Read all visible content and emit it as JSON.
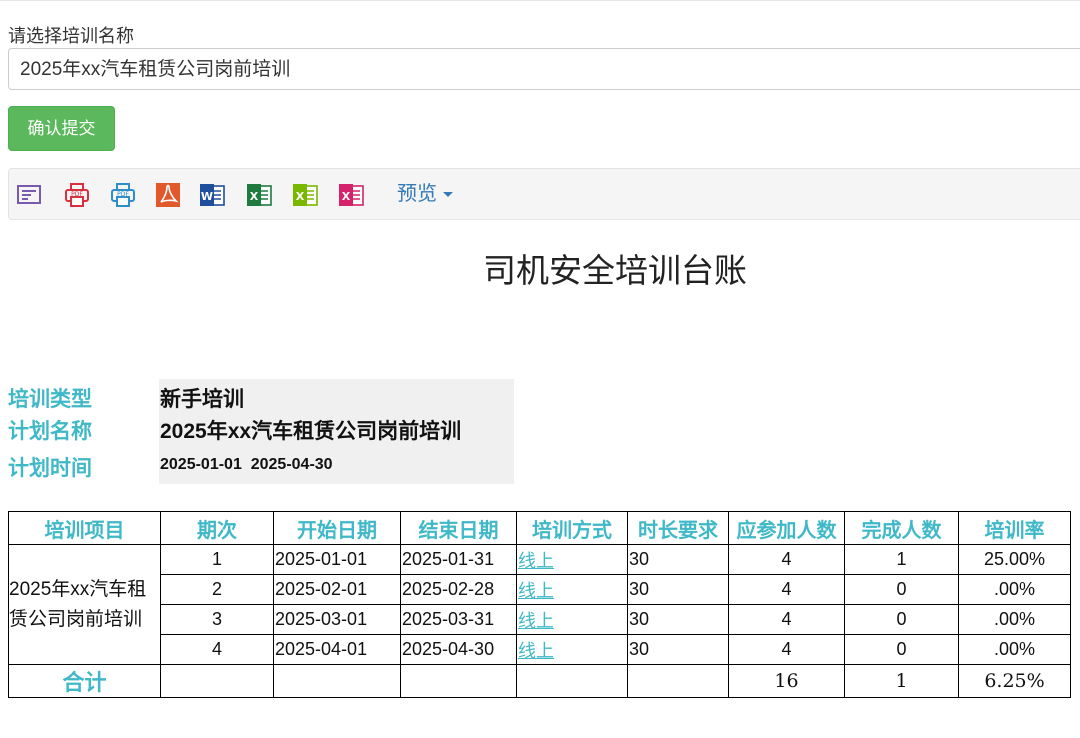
{
  "form": {
    "label": "请选择培训名称",
    "selected": "2025年xx汽车租赁公司岗前培训",
    "submit_label": "确认提交"
  },
  "toolbar": {
    "icons": [
      "print-icon",
      "print-pdf-icon",
      "print-pdf-alt-icon",
      "pdf-export-icon",
      "word-export-icon",
      "excel-export-icon",
      "excel-alt-export-icon",
      "excel-pink-export-icon"
    ],
    "preview_label": "预览"
  },
  "report": {
    "title": "司机安全培训台账",
    "info": {
      "type_label": "培训类型",
      "type_value": "新手培训",
      "plan_label": "计划名称",
      "plan_value": "2025年xx汽车租赁公司岗前培训",
      "time_label": "计划时间",
      "time_start": "2025-01-01",
      "time_end": "2025-04-30"
    },
    "table": {
      "headers": [
        "培训项目",
        "期次",
        "开始日期",
        "结束日期",
        "培训方式",
        "时长要求",
        "应参加人数",
        "完成人数",
        "培训率"
      ],
      "project": "2025年xx汽车租赁公司岗前培训",
      "rows": [
        {
          "period": "1",
          "start": "2025-01-01",
          "end": "2025-01-31",
          "mode": "线上",
          "duration": "30",
          "expected": "4",
          "done": "1",
          "rate": "25.00%"
        },
        {
          "period": "2",
          "start": "2025-02-01",
          "end": "2025-02-28",
          "mode": "线上",
          "duration": "30",
          "expected": "4",
          "done": "0",
          "rate": ".00%"
        },
        {
          "period": "3",
          "start": "2025-03-01",
          "end": "2025-03-31",
          "mode": "线上",
          "duration": "30",
          "expected": "4",
          "done": "0",
          "rate": ".00%"
        },
        {
          "period": "4",
          "start": "2025-04-01",
          "end": "2025-04-30",
          "mode": "线上",
          "duration": "30",
          "expected": "4",
          "done": "0",
          "rate": ".00%"
        }
      ],
      "total": {
        "label": "合计",
        "expected": "16",
        "done": "1",
        "rate": "6.25%"
      }
    }
  },
  "colors": {
    "accent": "#3fb8c7",
    "submit": "#5cb85c",
    "link": "#337ab7"
  }
}
